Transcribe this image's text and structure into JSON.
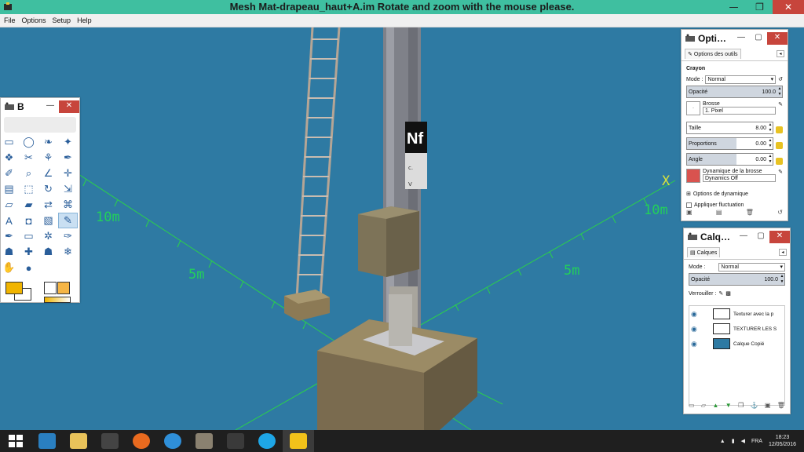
{
  "window": {
    "title": "Mesh Mat-drapeau_haut+A.im      Rotate and zoom with the mouse please.",
    "minimize": "—",
    "maximize": "❐",
    "close": "✕"
  },
  "menu": [
    "File",
    "Options",
    "Setup",
    "Help"
  ],
  "viewport": {
    "axis_labels": {
      "left_10m": "10m",
      "left_5m": "5m",
      "right_10m": "10m",
      "right_5m": "5m",
      "x_axis": "X"
    },
    "sign_letters": "Nf",
    "sign_small": "c.",
    "sign_small2": "V"
  },
  "toolbox": {
    "title": "B",
    "tool_icons": [
      "rect-select-icon",
      "ellipse-select-icon",
      "lasso-icon",
      "fuzzy-select-icon",
      "color-select-icon",
      "scissors-icon",
      "foreground-select-icon",
      "paths-icon",
      "color-picker-icon",
      "zoom-icon",
      "measure-icon",
      "move-icon",
      "align-icon",
      "crop-icon",
      "rotate-icon",
      "scale-icon",
      "shear-icon",
      "perspective-icon",
      "flip-icon",
      "cage-icon",
      "text-icon",
      "bucket-fill-icon",
      "blend-icon",
      "pencil-icon",
      "paintbrush-icon",
      "eraser-icon",
      "airbrush-icon",
      "ink-icon",
      "clone-icon",
      "heal-icon",
      "perspective-clone-icon",
      "blur-icon",
      "smudge-icon",
      "dodge-burn-icon"
    ],
    "tool_glyphs": [
      "▭",
      "◯",
      "❧",
      "✦",
      "❖",
      "✂",
      "⚘",
      "✒",
      "✐",
      "⌕",
      "∠",
      "✛",
      "▤",
      "⬚",
      "↻",
      "⇲",
      "▱",
      "▰",
      "⇄",
      "⌘",
      "A",
      "◘",
      "▧",
      "✎",
      "✒",
      "▭",
      "✲",
      "✑",
      "☗",
      "✚",
      "☗",
      "❄",
      "✋",
      "●"
    ],
    "active_index": 23,
    "foreground_color": "#f0b400",
    "background_color": "#ffffff"
  },
  "tool_options": {
    "title": "Opti…",
    "tab_label": "Options des outils",
    "tool_name": "Crayon",
    "mode_label": "Mode :",
    "mode_value": "Normal",
    "opacity_label": "Opacité",
    "opacity_value": "100.0",
    "brush_label": "Brosse",
    "brush_value": "1. Pixel",
    "size_label": "Taille",
    "size_value": "8.00",
    "proportions_label": "Proportions",
    "proportions_value": "0.00",
    "angle_label": "Angle",
    "angle_value": "0.00",
    "dynamics_label": "Dynamique de la brosse",
    "dynamics_value": "Dynamics Off",
    "dynamics_options": "Options de dynamique",
    "fluctuation_label": "Appliquer fluctuation"
  },
  "layers": {
    "title": "Calq…",
    "tab_label": "Calques",
    "mode_label": "Mode :",
    "mode_value": "Normal",
    "opacity_label": "Opacité",
    "opacity_value": "100.0",
    "lock_label": "Verrouiller :",
    "items": [
      {
        "name": "Texturer avec la p"
      },
      {
        "name": "TEXTURER LES S"
      },
      {
        "name": "Calque Copié"
      }
    ]
  },
  "taskbar": {
    "language": "FRA",
    "time": "18:23",
    "date": "12/05/2016",
    "apps": [
      "windows-start-icon",
      "cc3-icon",
      "file-explorer-icon",
      "game-app-icon",
      "firefox-icon",
      "internet-explorer-icon",
      "gimp-icon",
      "game-app-2-icon",
      "skype-icon",
      "train-app-icon"
    ]
  }
}
